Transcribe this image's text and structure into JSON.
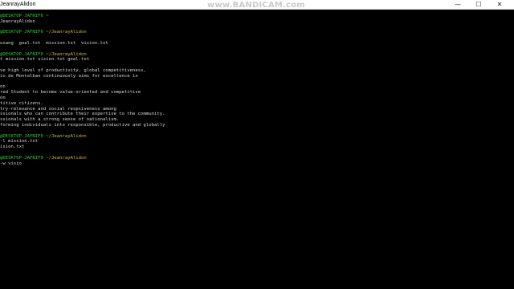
{
  "window": {
    "title": "JeanrayAlidon",
    "watermark": "www.BANDICAM.com",
    "controls": {
      "minimize": "—",
      "maximize": "☐",
      "close": "✕"
    }
  },
  "terminal": {
    "lines": [
      {
        "type": "prompt",
        "user": "@DESKTOP-JAFNIF0",
        "path": "~"
      },
      {
        "type": "output",
        "text": "JeanrayAlidon"
      },
      {
        "type": "blank"
      },
      {
        "type": "prompt",
        "user": "@DESKTOP-JAFNIF0",
        "path": "~/JeanrayAlidon"
      },
      {
        "type": "blank"
      },
      {
        "type": "output",
        "text": "usang  goal.txt  mission.txt  vision.txt"
      },
      {
        "type": "blank"
      },
      {
        "type": "prompt",
        "user": "@DESKTOP-JAFNIF0",
        "path": "~/JeanrayAlidon"
      },
      {
        "type": "output",
        "text": "t mission.txt vision.txt goal.txt"
      },
      {
        "type": "blank"
      },
      {
        "type": "output",
        "text": "ve high level of productivity, global competitiveness,"
      },
      {
        "type": "output",
        "text": "io de Montalban continuously aims for excellence in"
      },
      {
        "type": "blank"
      },
      {
        "type": "output",
        "text": "on"
      },
      {
        "type": "output",
        "text": "red Student to become value-oriented and competitive"
      },
      {
        "type": "output",
        "text": "on"
      },
      {
        "type": "output",
        "text": "titive citizens."
      },
      {
        "type": "output",
        "text": "try-relevance and social respsiveness among"
      },
      {
        "type": "output",
        "text": "ssionals who can contribute their expertise to the community."
      },
      {
        "type": "output",
        "text": "ssionals with a strong sense of nationalism."
      },
      {
        "type": "output",
        "text": "forming individuals into responsible, productive and globally"
      },
      {
        "type": "blank"
      },
      {
        "type": "prompt",
        "user": "@DESKTOP-JAFNIF0",
        "path": "~/JeanrayAlidon"
      },
      {
        "type": "output",
        "text": "-l mission.txt"
      },
      {
        "type": "output",
        "text": "ision.txt"
      },
      {
        "type": "blank"
      },
      {
        "type": "prompt",
        "user": "@DESKTOP-JAFNIF0",
        "path": "~/JeanrayAlidon"
      },
      {
        "type": "output",
        "text": "-w visio"
      }
    ]
  }
}
